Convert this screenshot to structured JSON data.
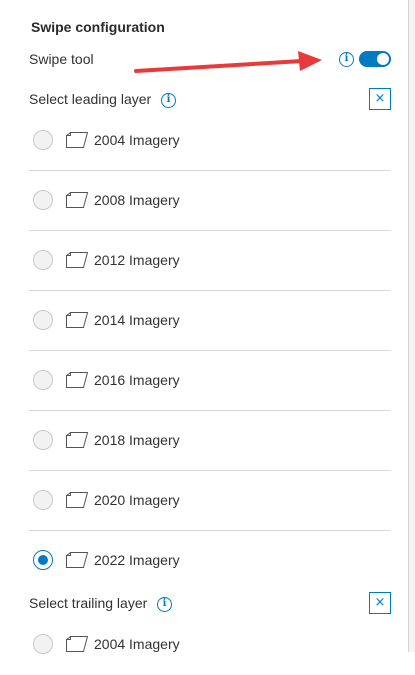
{
  "swipe": {
    "section_title": "Swipe configuration",
    "tool_label": "Swipe tool",
    "tool_enabled": true,
    "info_glyph": "i",
    "close_glyph": "×",
    "leading": {
      "label": "Select leading layer",
      "selected": "2022 Imagery",
      "layers": [
        {
          "name": "2004 Imagery",
          "checked": false
        },
        {
          "name": "2008 Imagery",
          "checked": false
        },
        {
          "name": "2012 Imagery",
          "checked": false
        },
        {
          "name": "2014 Imagery",
          "checked": false
        },
        {
          "name": "2016 Imagery",
          "checked": false
        },
        {
          "name": "2018 Imagery",
          "checked": false
        },
        {
          "name": "2020 Imagery",
          "checked": false
        },
        {
          "name": "2022 Imagery",
          "checked": true
        }
      ]
    },
    "trailing": {
      "label": "Select trailing layer",
      "layers": [
        {
          "name": "2004 Imagery",
          "checked": false
        }
      ]
    }
  },
  "colors": {
    "accent": "#007ac2",
    "annotation_arrow": "#e8393b"
  }
}
